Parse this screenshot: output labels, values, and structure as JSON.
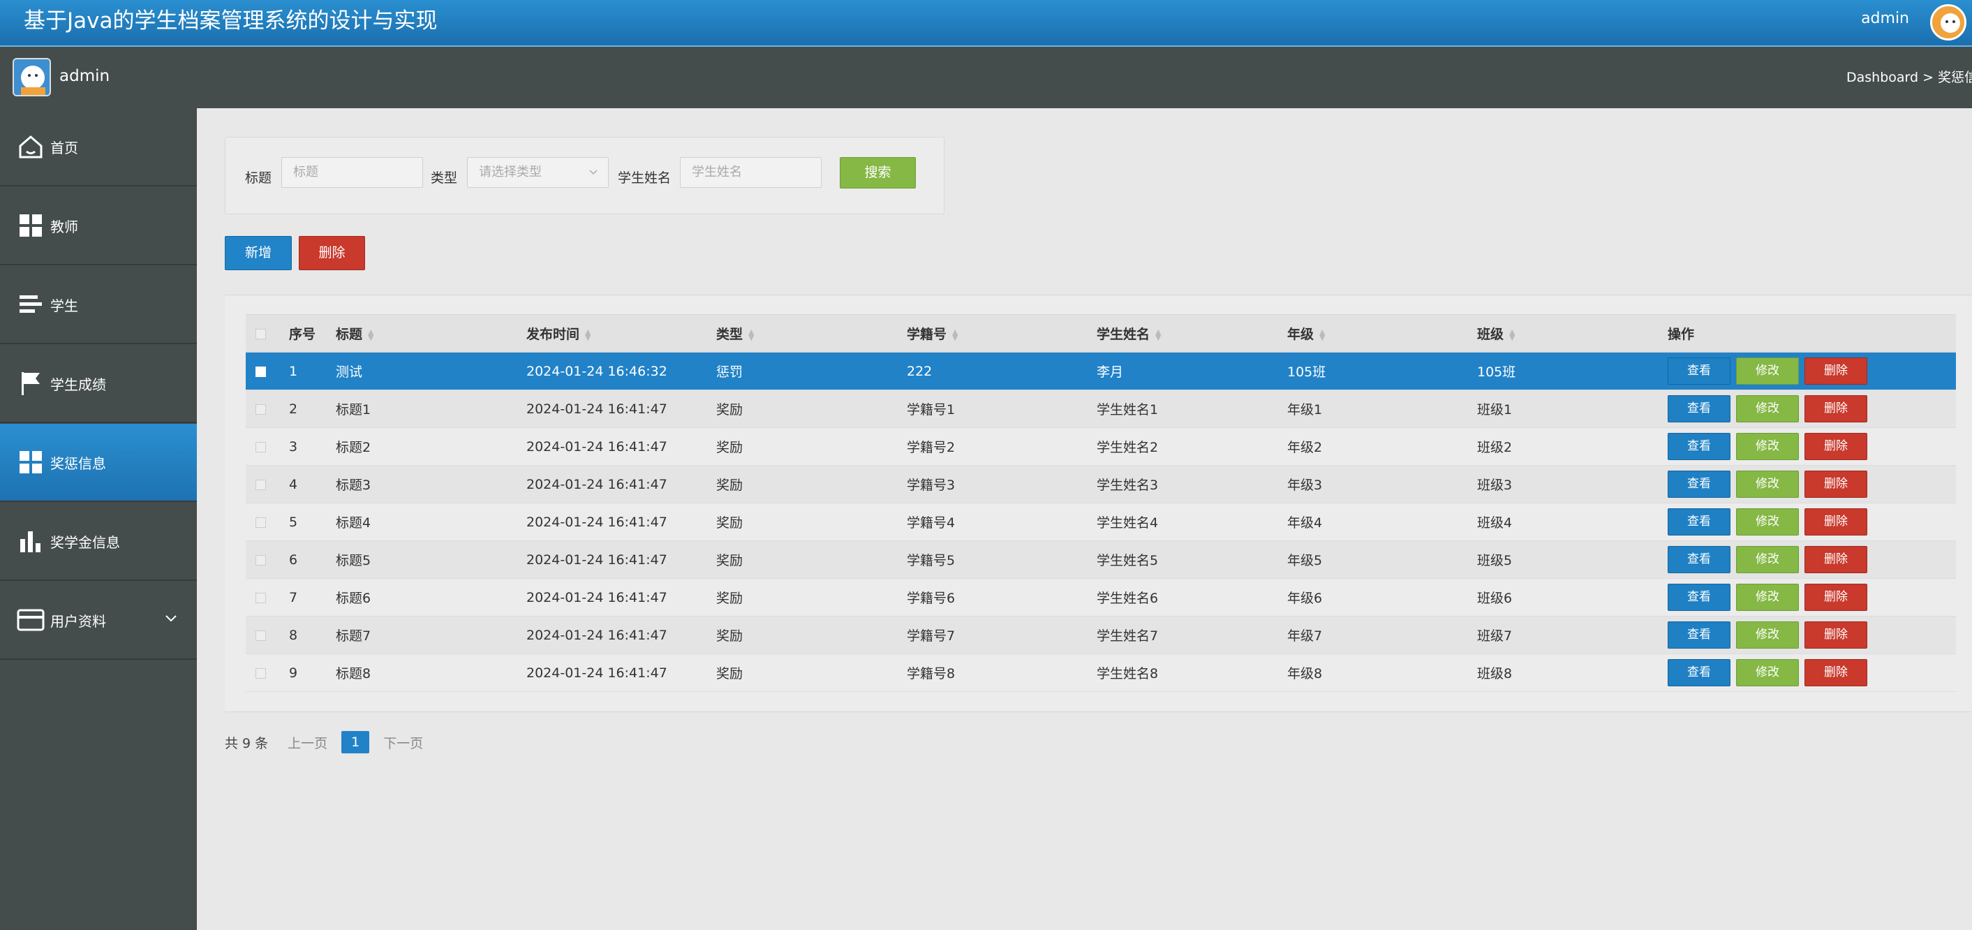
{
  "header": {
    "title": "基于Java的学生档案管理系统的设计与实现",
    "user": "admin"
  },
  "subbar": {
    "user_name": "admin",
    "breadcrumb": "Dashboard > 奖惩信息"
  },
  "sidebar": {
    "items": [
      {
        "label": "首页",
        "icon": "home-icon"
      },
      {
        "label": "教师",
        "icon": "grid-icon"
      },
      {
        "label": "学生",
        "icon": "list-icon"
      },
      {
        "label": "学生成绩",
        "icon": "flag-icon"
      },
      {
        "label": "奖惩信息",
        "icon": "grid-icon",
        "active": true
      },
      {
        "label": "奖学金信息",
        "icon": "bar-chart-icon"
      },
      {
        "label": "用户资料",
        "icon": "card-icon",
        "has_submenu": true
      }
    ]
  },
  "search": {
    "title_label": "标题",
    "title_placeholder": "标题",
    "type_label": "类型",
    "type_placeholder": "请选择类型",
    "name_label": "学生姓名",
    "name_placeholder": "学生姓名",
    "button": "搜索"
  },
  "actions": {
    "add": "新增",
    "delete": "删除"
  },
  "table": {
    "headers": [
      "序号",
      "标题",
      "发布时间",
      "类型",
      "学籍号",
      "学生姓名",
      "年级",
      "班级",
      "操作"
    ],
    "row_buttons": {
      "view": "查看",
      "edit": "修改",
      "delete": "删除"
    },
    "rows": [
      {
        "no": "1",
        "title": "测试",
        "time": "2024-01-24 16:46:32",
        "type": "惩罚",
        "sid": "222",
        "name": "李月",
        "grade": "105班",
        "class": "105班"
      },
      {
        "no": "2",
        "title": "标题1",
        "time": "2024-01-24 16:41:47",
        "type": "奖励",
        "sid": "学籍号1",
        "name": "学生姓名1",
        "grade": "年级1",
        "class": "班级1"
      },
      {
        "no": "3",
        "title": "标题2",
        "time": "2024-01-24 16:41:47",
        "type": "奖励",
        "sid": "学籍号2",
        "name": "学生姓名2",
        "grade": "年级2",
        "class": "班级2"
      },
      {
        "no": "4",
        "title": "标题3",
        "time": "2024-01-24 16:41:47",
        "type": "奖励",
        "sid": "学籍号3",
        "name": "学生姓名3",
        "grade": "年级3",
        "class": "班级3"
      },
      {
        "no": "5",
        "title": "标题4",
        "time": "2024-01-24 16:41:47",
        "type": "奖励",
        "sid": "学籍号4",
        "name": "学生姓名4",
        "grade": "年级4",
        "class": "班级4"
      },
      {
        "no": "6",
        "title": "标题5",
        "time": "2024-01-24 16:41:47",
        "type": "奖励",
        "sid": "学籍号5",
        "name": "学生姓名5",
        "grade": "年级5",
        "class": "班级5"
      },
      {
        "no": "7",
        "title": "标题6",
        "time": "2024-01-24 16:41:47",
        "type": "奖励",
        "sid": "学籍号6",
        "name": "学生姓名6",
        "grade": "年级6",
        "class": "班级6"
      },
      {
        "no": "8",
        "title": "标题7",
        "time": "2024-01-24 16:41:47",
        "type": "奖励",
        "sid": "学籍号7",
        "name": "学生姓名7",
        "grade": "年级7",
        "class": "班级7"
      },
      {
        "no": "9",
        "title": "标题8",
        "time": "2024-01-24 16:41:47",
        "type": "奖励",
        "sid": "学籍号8",
        "name": "学生姓名8",
        "grade": "年级8",
        "class": "班级8"
      }
    ]
  },
  "pager": {
    "total": "共 9 条",
    "prev": "上一页",
    "current": "1",
    "next": "下一页"
  }
}
